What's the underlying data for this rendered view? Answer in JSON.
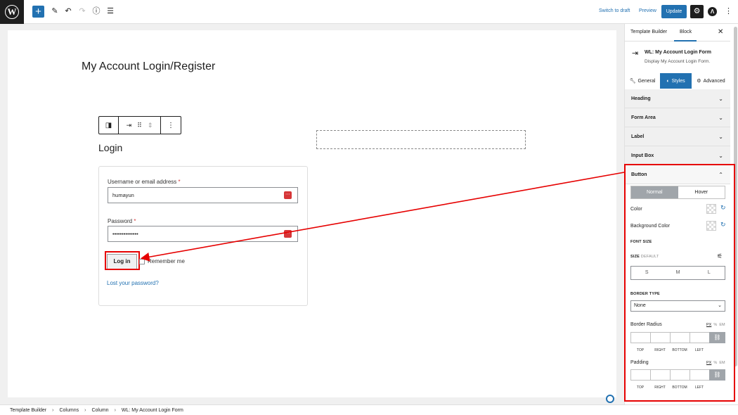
{
  "topbar": {
    "logo_glyph": "W",
    "add_glyph": "+",
    "switch_to_draft": "Switch to draft",
    "preview": "Preview",
    "update": "Update"
  },
  "canvas": {
    "page_title": "My Account Login/Register",
    "login_heading": "Login",
    "username_label": "Username or email address",
    "username_value": "humayun",
    "password_label": "Password",
    "password_value": "••••••••••••••",
    "required_mark": "*",
    "login_button": "Log in",
    "remember_me": "Remember me",
    "lost_password": "Lost your password?"
  },
  "sidebar": {
    "tabs": [
      "Template Builder",
      "Block"
    ],
    "block_title": "WL: My Account Login Form",
    "block_desc": "Display My Account Login Form.",
    "subtabs": [
      "General",
      "Styles",
      "Advanced"
    ],
    "panels": [
      "Heading",
      "Form Area",
      "Label",
      "Input Box",
      "Button"
    ],
    "button_panel": {
      "state_tabs": [
        "Normal",
        "Hover"
      ],
      "color_label": "Color",
      "bg_color_label": "Background Color",
      "font_size_label": "FONT SIZE",
      "size_label": "SIZE",
      "size_default": "DEFAULT",
      "sizes": [
        "S",
        "M",
        "L"
      ],
      "border_type_label": "BORDER TYPE",
      "border_type_value": "None",
      "border_radius_label": "Border Radius",
      "padding_label": "Padding",
      "units": [
        "PX",
        "%",
        "EM"
      ],
      "sides": [
        "TOP",
        "RIGHT",
        "BOTTOM",
        "LEFT"
      ]
    }
  },
  "breadcrumb": [
    "Template Builder",
    "Columns",
    "Column",
    "WL: My Account Login Form"
  ],
  "colors": {
    "accent": "#2271b1",
    "highlight": "#e60000",
    "required": "#d63638"
  },
  "icons": [
    "wordpress-logo-icon",
    "plus-icon",
    "pencil-icon",
    "undo-icon",
    "redo-icon",
    "info-icon",
    "list-view-icon",
    "gear-icon",
    "astra-icon",
    "more-vertical-icon",
    "close-icon",
    "login-block-icon",
    "chevron-down-icon",
    "chevron-up-icon",
    "reset-icon",
    "sliders-icon",
    "link-icon"
  ]
}
